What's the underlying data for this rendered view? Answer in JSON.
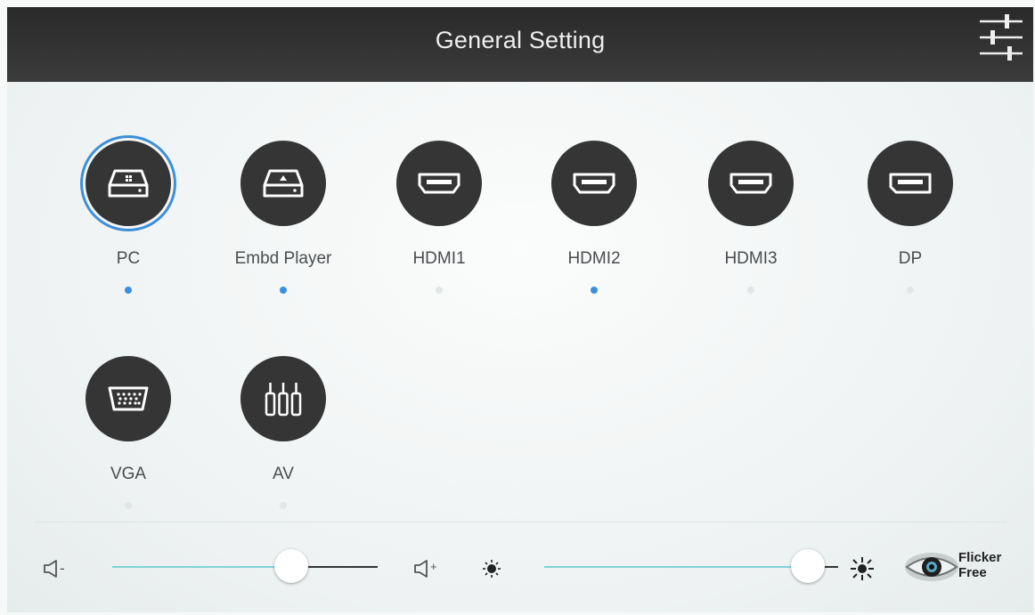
{
  "header": {
    "title": "General Setting",
    "settings_icon": "sliders-icon"
  },
  "sources": [
    {
      "label": "PC",
      "icon": "pc-drive-icon",
      "selected": true,
      "signal": true
    },
    {
      "label": "Embd Player",
      "icon": "embedded-player-icon",
      "selected": false,
      "signal": true
    },
    {
      "label": "HDMI1",
      "icon": "hdmi-icon",
      "selected": false,
      "signal": false
    },
    {
      "label": "HDMI2",
      "icon": "hdmi-icon",
      "selected": false,
      "signal": true
    },
    {
      "label": "HDMI3",
      "icon": "hdmi-icon",
      "selected": false,
      "signal": false
    },
    {
      "label": "DP",
      "icon": "displayport-icon",
      "selected": false,
      "signal": false
    },
    {
      "label": "VGA",
      "icon": "vga-icon",
      "selected": false,
      "signal": false
    },
    {
      "label": "AV",
      "icon": "av-icon",
      "selected": false,
      "signal": false
    }
  ],
  "controls": {
    "volume": {
      "value_fraction": 0.7,
      "icon_down": "volume-down-icon",
      "icon_up": "volume-up-icon",
      "down_label": "-",
      "up_label": "+"
    },
    "brightness": {
      "value_fraction": 0.95,
      "icon_low": "brightness-low-icon",
      "icon_high": "brightness-high-icon"
    },
    "flicker_free": {
      "line1": "Flicker",
      "line2": "Free",
      "icon": "eye-icon"
    }
  },
  "colors": {
    "accent": "#3b8fdc",
    "slider_fill": "#7fd3d6",
    "slider_rest": "#333333",
    "header_bg": "#333333",
    "circle_bg": "#353535"
  }
}
